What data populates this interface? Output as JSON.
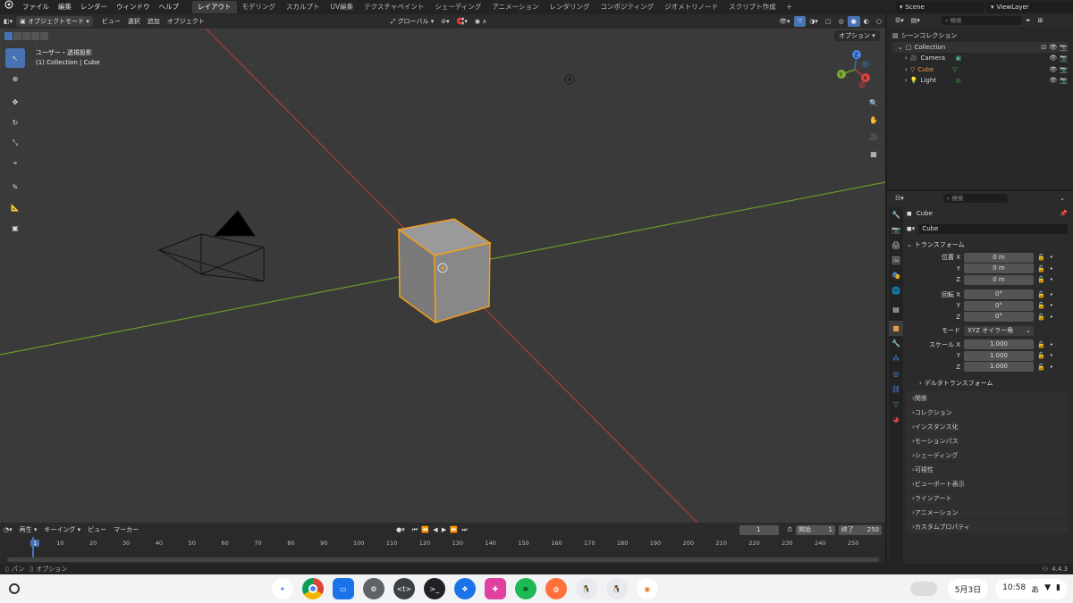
{
  "topbar": {
    "menus": [
      "ファイル",
      "編集",
      "レンダー",
      "ウィンドウ",
      "ヘルプ"
    ],
    "workspaces": [
      "レイアウト",
      "モデリング",
      "スカルプト",
      "UV編集",
      "テクスチャペイント",
      "シェーディング",
      "アニメーション",
      "レンダリング",
      "コンポジティング",
      "ジオメトリノード",
      "スクリプト作成"
    ],
    "add_tab": "+",
    "scene": "Scene",
    "view_layer": "ViewLayer"
  },
  "vp_header": {
    "mode": "オブジェクトモード",
    "menus": [
      "ビュー",
      "選択",
      "追加",
      "オブジェクト"
    ],
    "orientation": "グローバル",
    "options": "オプション"
  },
  "viewport": {
    "view_name": "ユーザー・透視投影",
    "collection_path": "(1) Collection | Cube"
  },
  "gizmo": {
    "x": "X",
    "y": "Y",
    "z": "Z"
  },
  "outliner": {
    "search_placeholder": "検索",
    "root": "シーンコレクション",
    "collection": "Collection",
    "items": [
      {
        "name": "Camera",
        "color": "#e89a4b"
      },
      {
        "name": "Cube",
        "color": "#e89a4b"
      },
      {
        "name": "Light",
        "color": "#e89a4b"
      }
    ]
  },
  "props": {
    "search_placeholder": "検索",
    "object_name": "Cube",
    "data_name": "Cube",
    "transform_title": "トランスフォーム",
    "location": {
      "label": "位置 X",
      "x": "0 m",
      "y": "0 m",
      "z": "0 m"
    },
    "rotation": {
      "label": "回転 X",
      "x": "0°",
      "y": "0°",
      "z": "0°"
    },
    "mode_label": "モード",
    "mode_value": "XYZ オイラー角",
    "scale": {
      "label": "スケール X",
      "x": "1.000",
      "y": "1.000",
      "z": "1.000"
    },
    "axis_y": "Y",
    "axis_z": "Z",
    "delta": "デルタトランスフォーム",
    "panels": [
      "関係",
      "コレクション",
      "インスタンス化",
      "モーションパス",
      "シェーディング",
      "可視性",
      "ビューポート表示",
      "ラインアート",
      "アニメーション",
      "カスタムプロパティ"
    ]
  },
  "timeline": {
    "menus": [
      "再生",
      "キーイング",
      "ビュー",
      "マーカー"
    ],
    "current": "1",
    "start_label": "開始",
    "start": "1",
    "end_label": "終了",
    "end": "250",
    "ticks": [
      "1",
      "10",
      "20",
      "30",
      "40",
      "50",
      "60",
      "70",
      "80",
      "90",
      "100",
      "110",
      "120",
      "130",
      "140",
      "150",
      "160",
      "170",
      "180",
      "190",
      "200",
      "210",
      "220",
      "230",
      "240",
      "250"
    ]
  },
  "status": {
    "pan": "パン",
    "options": "オプション",
    "version": "4.4.3"
  },
  "taskbar": {
    "date": "5月3日",
    "ime": "あ",
    "time": "10:58"
  },
  "colors": {
    "accent": "#4772b3",
    "selection": "#f29e1b",
    "x_axis": "#b03a3a",
    "y_axis": "#6b9a2a"
  }
}
